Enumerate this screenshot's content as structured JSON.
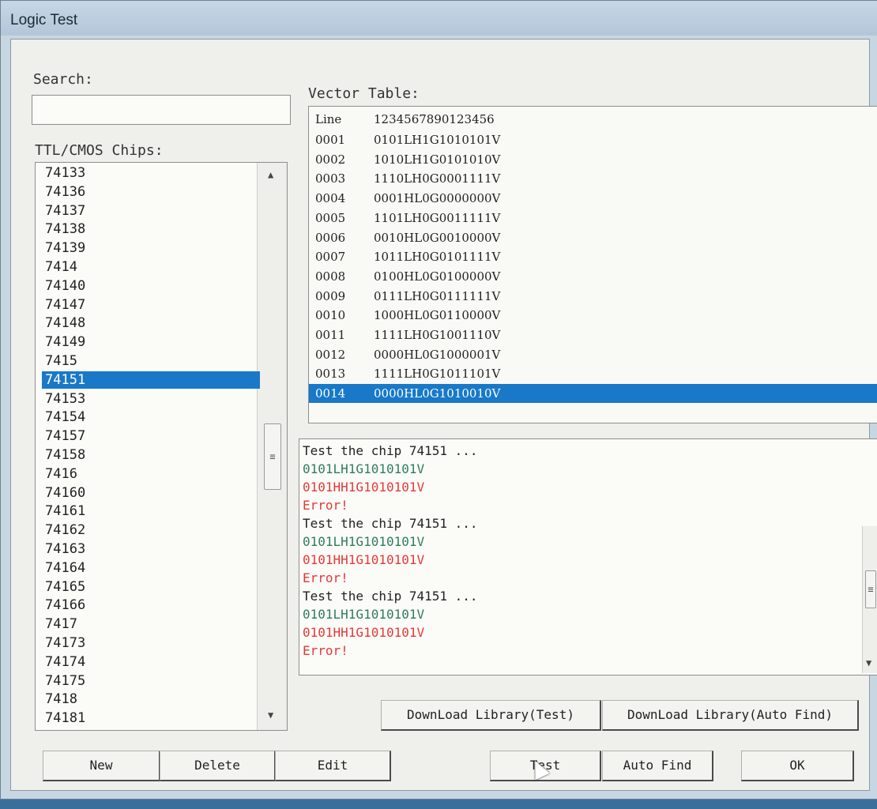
{
  "window": {
    "title": "Logic Test"
  },
  "search": {
    "label": "Search:",
    "value": ""
  },
  "chips": {
    "label": "TTL/CMOS Chips:",
    "items": [
      "74133",
      "74136",
      "74137",
      "74138",
      "74139",
      "7414",
      "74140",
      "74147",
      "74148",
      "74149",
      "7415",
      "74151",
      "74153",
      "74154",
      "74157",
      "74158",
      "7416",
      "74160",
      "74161",
      "74162",
      "74163",
      "74164",
      "74165",
      "74166",
      "7417",
      "74173",
      "74174",
      "74175",
      "7418",
      "74181"
    ],
    "selected": "74151"
  },
  "vector_table": {
    "label": "Vector Table:",
    "header": {
      "line": "Line",
      "vector": "1234567890123456"
    },
    "rows": [
      {
        "line": "0001",
        "vector": "0101LH1G1010101V"
      },
      {
        "line": "0002",
        "vector": "1010LH1G0101010V"
      },
      {
        "line": "0003",
        "vector": "1110LH0G0001111V"
      },
      {
        "line": "0004",
        "vector": "0001HL0G0000000V"
      },
      {
        "line": "0005",
        "vector": "1101LH0G0011111V"
      },
      {
        "line": "0006",
        "vector": "0010HL0G0010000V"
      },
      {
        "line": "0007",
        "vector": "1011LH0G0101111V"
      },
      {
        "line": "0008",
        "vector": "0100HL0G0100000V"
      },
      {
        "line": "0009",
        "vector": "0111LH0G0111111V"
      },
      {
        "line": "0010",
        "vector": "1000HL0G0110000V"
      },
      {
        "line": "0011",
        "vector": "1111LH0G1001110V"
      },
      {
        "line": "0012",
        "vector": "0000HL0G1000001V"
      },
      {
        "line": "0013",
        "vector": "1111LH0G1011101V"
      },
      {
        "line": "0014",
        "vector": "0000HL0G1010010V"
      }
    ],
    "selected": "0014"
  },
  "log": {
    "lines": [
      {
        "text": "Test the chip 74151 ...",
        "kind": "info"
      },
      {
        "text": "0101LH1G1010101V",
        "kind": "expected"
      },
      {
        "text": "0101HH1G1010101V",
        "kind": "actual"
      },
      {
        "text": "Error!",
        "kind": "error"
      },
      {
        "text": "Test the chip 74151 ...",
        "kind": "info"
      },
      {
        "text": "0101LH1G1010101V",
        "kind": "expected"
      },
      {
        "text": "0101HH1G1010101V",
        "kind": "actual"
      },
      {
        "text": "Error!",
        "kind": "error"
      },
      {
        "text": "Test the chip 74151 ...",
        "kind": "info"
      },
      {
        "text": "0101LH1G1010101V",
        "kind": "expected"
      },
      {
        "text": "0101HH1G1010101V",
        "kind": "actual"
      },
      {
        "text": "Error!",
        "kind": "error"
      }
    ],
    "colors": {
      "info": "#222222",
      "expected": "#2e7d5b",
      "actual": "#e53935",
      "error": "#e53935"
    }
  },
  "buttons": {
    "download_test": "DownLoad Library(Test)",
    "download_auto": "DownLoad Library(Auto Find)",
    "new": "New",
    "delete": "Delete",
    "edit": "Edit",
    "test": "Test",
    "auto_find": "Auto Find",
    "ok": "OK"
  },
  "colors": {
    "selection": "#1979c8"
  }
}
